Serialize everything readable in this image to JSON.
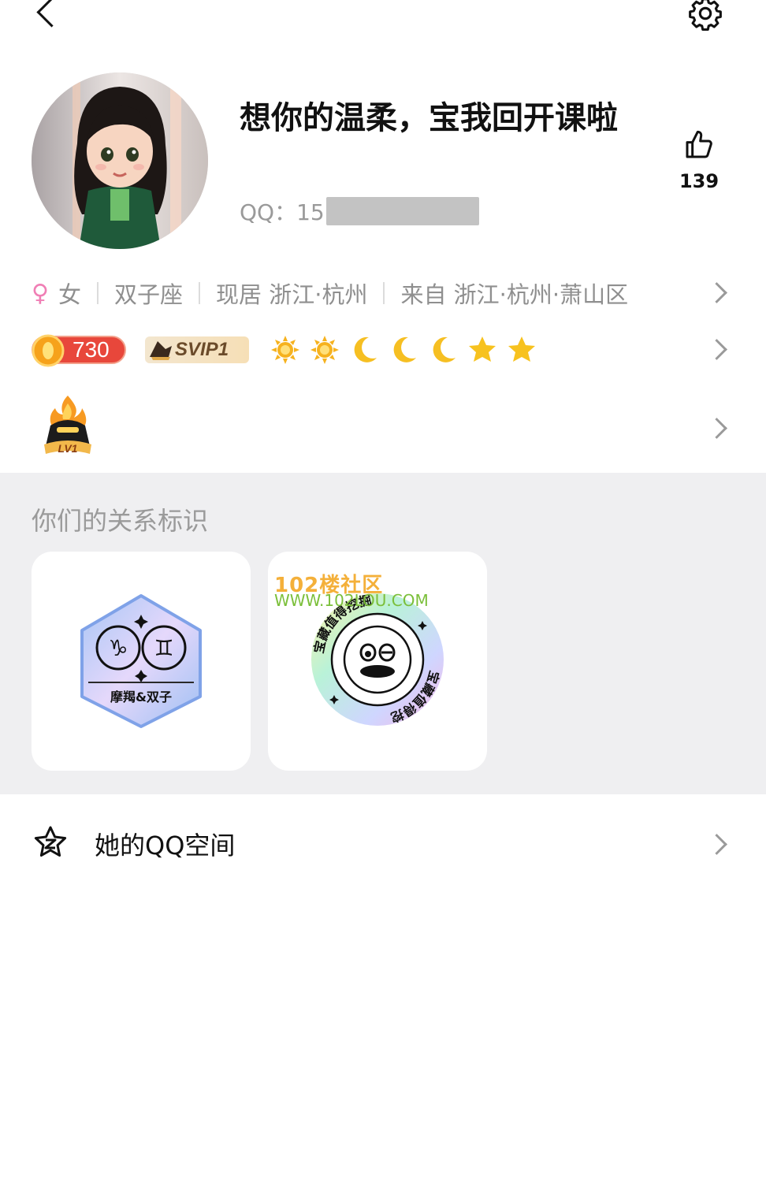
{
  "profile": {
    "nickname": "想你的温柔，宝我回开课啦",
    "qq_label": "QQ：15",
    "like_count": "139"
  },
  "info": {
    "gender": "女",
    "zodiac": "双子座",
    "current_city": "现居 浙江·杭州",
    "hometown": "来自 浙江·杭州·萧山区"
  },
  "badges": {
    "level": "730",
    "svip": "SVIP1",
    "grade_icons": [
      "sun-icon",
      "sun-icon",
      "moon-icon",
      "moon-icon",
      "moon-icon",
      "star-icon",
      "star-icon"
    ]
  },
  "fire_level": {
    "label": "LV1"
  },
  "relationship": {
    "title": "你们的关系标识",
    "cards": [
      {
        "label": "摩羯&双子"
      },
      {
        "ring_text": "宝藏值得挖掘"
      }
    ],
    "watermark": {
      "cn": "102楼社区",
      "url": "WWW.102LOU.COM"
    }
  },
  "qzone": {
    "label": "她的QQ空间"
  },
  "colors": {
    "gender_pink": "#f07fb5",
    "level_red": "#e8473b",
    "section_bg": "#efeff1"
  }
}
